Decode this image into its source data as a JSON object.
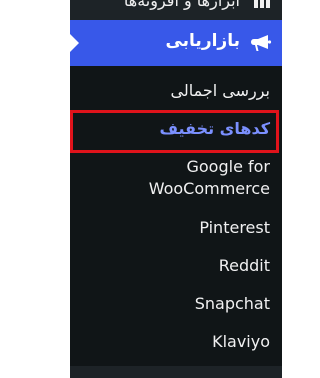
{
  "sidebar": {
    "top_item": {
      "label": "ابزارها و افزونه‌ها",
      "icon": "grid-icon"
    },
    "marketing": {
      "label": "بازاریابی",
      "icon": "megaphone-icon"
    },
    "submenu": [
      {
        "label": "بررسی اجمالی",
        "active": false
      },
      {
        "label": "کدهای تخفیف",
        "active": true
      },
      {
        "label_line1": "Google for",
        "label_line2": "WooCommerce",
        "active": false
      },
      {
        "label": "Pinterest",
        "active": false
      },
      {
        "label": "Reddit",
        "active": false
      },
      {
        "label": "Snapchat",
        "active": false
      },
      {
        "label": "Klaviyo",
        "active": false
      }
    ]
  },
  "colors": {
    "sidebar_bg": "#1d2327",
    "submenu_bg": "#101517",
    "accent": "#3858e9",
    "active_text": "#7b90ff",
    "highlight_border": "#e0131b"
  }
}
